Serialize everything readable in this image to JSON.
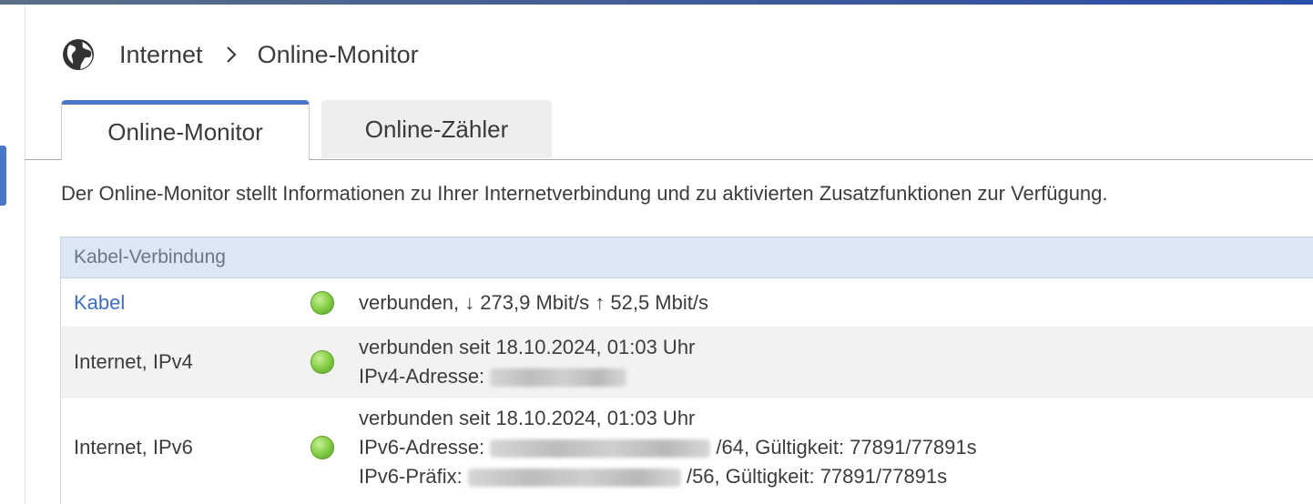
{
  "breadcrumb": {
    "parent": "Internet",
    "current": "Online-Monitor",
    "icon": "globe-icon",
    "separator_icon": "chevron-right-icon"
  },
  "tabs": [
    {
      "label": "Online-Monitor",
      "active": true
    },
    {
      "label": "Online-Zähler",
      "active": false
    }
  ],
  "intro": "Der Online-Monitor stellt Informationen zu Ihrer Internetverbindung und zu aktivierten Zusatzfunktionen zur Verfügung.",
  "colors": {
    "accent": "#4a77c9",
    "link": "#3f6ec4",
    "status_ok": "#8fd34f",
    "header_bg": "#dde7f3"
  },
  "table": {
    "header": "Kabel-Verbindung",
    "rows": [
      {
        "label": "Kabel",
        "status": "connected",
        "value": "verbunden, ↓ 273,9 Mbit/s ↑ 52,5 Mbit/s"
      },
      {
        "label": "Internet, IPv4",
        "status": "connected",
        "line1": "verbunden seit 18.10.2024, 01:03 Uhr",
        "line2_prefix": "IPv4-Adresse:"
      },
      {
        "label": "Internet, IPv6",
        "status": "connected",
        "line1": "verbunden seit 18.10.2024, 01:03 Uhr",
        "line2_prefix": "IPv6-Adresse:",
        "line2_suffix": "/64, Gültigkeit: 77891/77891s",
        "line3_prefix": "IPv6-Präfix:",
        "line3_suffix": "/56, Gültigkeit: 77891/77891s"
      }
    ]
  }
}
